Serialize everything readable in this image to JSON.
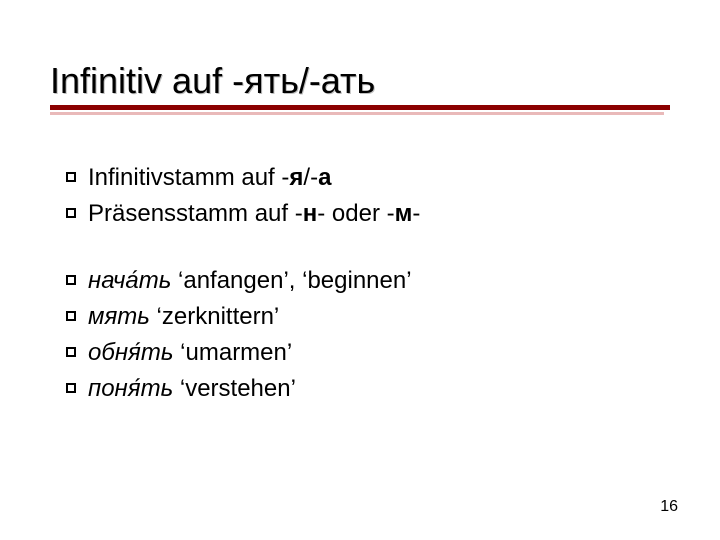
{
  "title": "Infinitiv auf -ять/-ать",
  "group1": [
    {
      "prefix": "Infinitivstamm auf -",
      "bold": "я",
      "mid": "/-",
      "bold2": "а",
      "suffix": ""
    },
    {
      "prefix": "Präsensstamm auf -",
      "bold": "н",
      "mid": "- oder -",
      "bold2": "м",
      "suffix": "-"
    }
  ],
  "group2": [
    {
      "word": "нача́ть",
      "gloss": " ‘anfangen’, ‘beginnen’"
    },
    {
      "word": "мять",
      "gloss": " ‘zerknittern’"
    },
    {
      "word": "обня́ть",
      "gloss": " ‘umarmen’"
    },
    {
      "word": "поня́ть",
      "gloss": " ‘verstehen’"
    }
  ],
  "page": "16"
}
